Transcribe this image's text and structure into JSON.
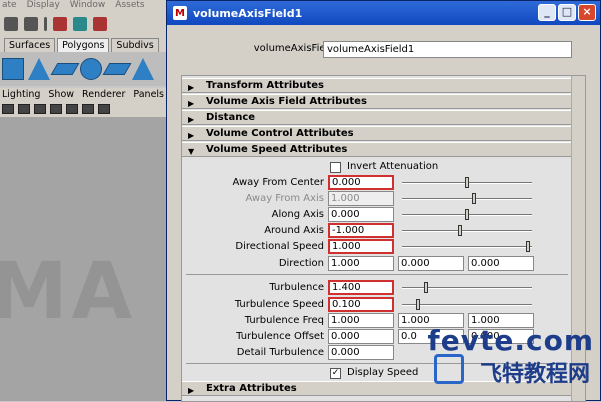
{
  "bg_menu": [
    "ate",
    "Display",
    "Window",
    "Assets"
  ],
  "shelf_tabs": [
    "Surfaces",
    "Polygons",
    "Subdivs"
  ],
  "panel_menu": [
    "Lighting",
    "Show",
    "Renderer",
    "Panels"
  ],
  "viewport_watermark": "MA",
  "dialog": {
    "title": "volumeAxisField1",
    "field_label": "volumeAxisField:",
    "field_value": "volumeAxisField1"
  },
  "sections": {
    "transform": "Transform Attributes",
    "volume_axis": "Volume Axis Field Attributes",
    "distance": "Distance",
    "volume_control": "Volume Control Attributes",
    "volume_speed": "Volume Speed Attributes",
    "extra": "Extra Attributes"
  },
  "invert_attenuation": "Invert Attenuation",
  "attributes": {
    "away_from_center": {
      "label": "Away From Center",
      "value": "0.000"
    },
    "away_from_axis": {
      "label": "Away From Axis",
      "value": "1.000"
    },
    "along_axis": {
      "label": "Along Axis",
      "value": "0.000"
    },
    "around_axis": {
      "label": "Around Axis",
      "value": "-1.000"
    },
    "directional_speed": {
      "label": "Directional Speed",
      "value": "1.000"
    },
    "direction": {
      "label": "Direction",
      "v1": "1.000",
      "v2": "0.000",
      "v3": "0.000"
    },
    "turbulence": {
      "label": "Turbulence",
      "value": "1.400"
    },
    "turbulence_speed": {
      "label": "Turbulence Speed",
      "value": "0.100"
    },
    "turbulence_freq": {
      "label": "Turbulence Freq",
      "v1": "1.000",
      "v2": "1.000",
      "v3": "1.000"
    },
    "turbulence_offset": {
      "label": "Turbulence Offset",
      "v1": "0.000",
      "v2": "0.0",
      "v3": "0.000"
    },
    "detail_turbulence": {
      "label": "Detail Turbulence",
      "value": "0.000"
    }
  },
  "display_speed": "Display Speed",
  "logo": {
    "main": "fevte.com",
    "sub": "飞特教程网"
  }
}
